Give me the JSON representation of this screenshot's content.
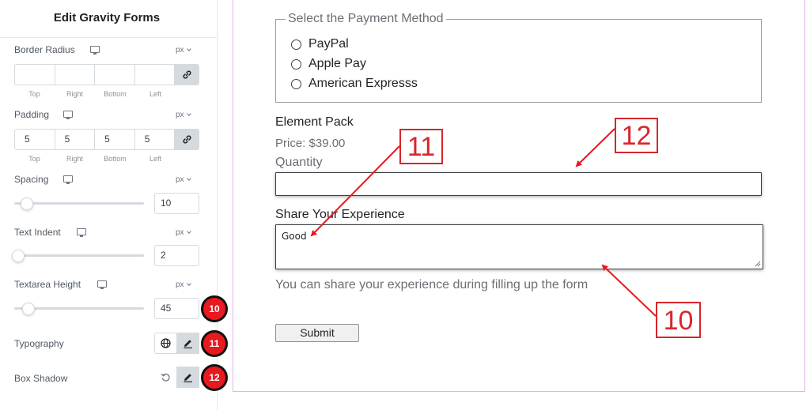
{
  "panel": {
    "title": "Edit Gravity Forms",
    "border_radius": {
      "label": "Border Radius",
      "unit": "px",
      "values": [
        "",
        "",
        "",
        ""
      ],
      "side_labels": [
        "Top",
        "Right",
        "Bottom",
        "Left"
      ]
    },
    "padding": {
      "label": "Padding",
      "unit": "px",
      "values": [
        "5",
        "5",
        "5",
        "5"
      ],
      "side_labels": [
        "Top",
        "Right",
        "Bottom",
        "Left"
      ]
    },
    "spacing": {
      "label": "Spacing",
      "unit": "px",
      "value": "10",
      "slider_fraction": 0.1
    },
    "text_indent": {
      "label": "Text Indent",
      "unit": "px",
      "value": "2",
      "slider_fraction": 0.02
    },
    "textarea_height": {
      "label": "Textarea Height",
      "unit": "px",
      "value": "45",
      "slider_fraction": 0.1
    },
    "typography": {
      "label": "Typography"
    },
    "box_shadow": {
      "label": "Box Shadow"
    },
    "badges": [
      "10",
      "11",
      "12"
    ]
  },
  "form": {
    "payment_legend": "Select the Payment Method",
    "payment_options": [
      "PayPal",
      "Apple Pay",
      "American Expresss"
    ],
    "product_name": "Element Pack",
    "price": "Price: $39.00",
    "quantity_label": "Quantity",
    "quantity_value": "",
    "experience_label": "Share Your Experience",
    "experience_value": "Good",
    "hint": "You can share your experience during filling up the form",
    "submit_label": "Submit"
  },
  "annotations": [
    "11",
    "12",
    "10"
  ],
  "colors": {
    "badge_red": "#e8191f",
    "annotation_red": "#d9252b",
    "preview_border": "#e6b2e6"
  }
}
